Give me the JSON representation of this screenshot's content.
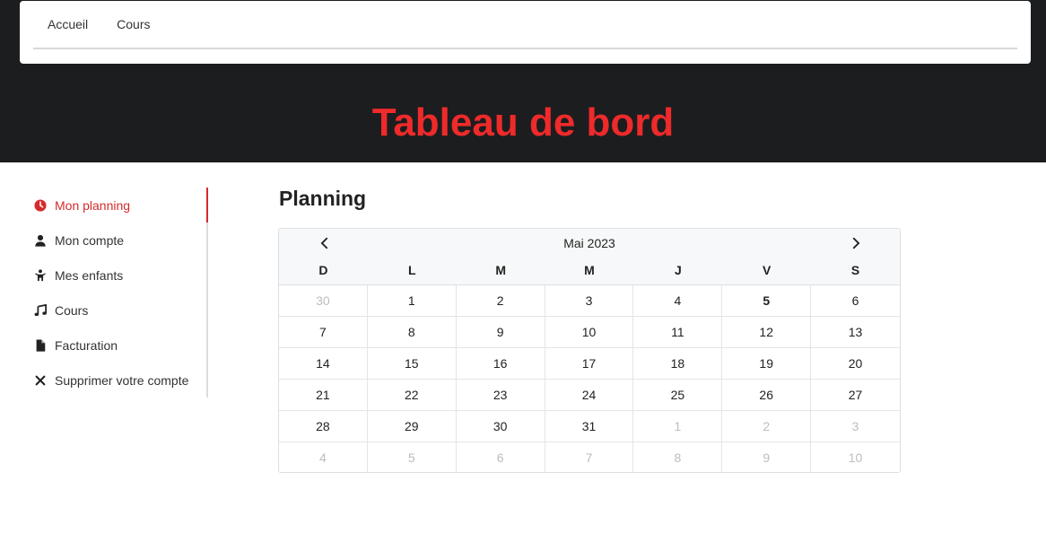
{
  "nav": {
    "items": [
      {
        "label": "Accueil"
      },
      {
        "label": "Cours"
      }
    ]
  },
  "hero": {
    "title": "Tableau de bord"
  },
  "sidebar": {
    "items": [
      {
        "label": "Mon planning",
        "icon": "clock-icon",
        "active": true
      },
      {
        "label": "Mon compte",
        "icon": "user-icon"
      },
      {
        "label": "Mes enfants",
        "icon": "child-icon"
      },
      {
        "label": "Cours",
        "icon": "music-icon"
      },
      {
        "label": "Facturation",
        "icon": "file-icon"
      },
      {
        "label": "Supprimer votre compte",
        "icon": "close-icon"
      }
    ]
  },
  "planning": {
    "title": "Planning",
    "month": "Mai 2023",
    "weekdays": [
      "D",
      "L",
      "M",
      "M",
      "J",
      "V",
      "S"
    ],
    "days": [
      {
        "n": "30",
        "muted": true
      },
      {
        "n": "1"
      },
      {
        "n": "2"
      },
      {
        "n": "3"
      },
      {
        "n": "4"
      },
      {
        "n": "5",
        "today": true
      },
      {
        "n": "6"
      },
      {
        "n": "7"
      },
      {
        "n": "8"
      },
      {
        "n": "9"
      },
      {
        "n": "10"
      },
      {
        "n": "11"
      },
      {
        "n": "12"
      },
      {
        "n": "13"
      },
      {
        "n": "14"
      },
      {
        "n": "15"
      },
      {
        "n": "16"
      },
      {
        "n": "17"
      },
      {
        "n": "18"
      },
      {
        "n": "19"
      },
      {
        "n": "20"
      },
      {
        "n": "21"
      },
      {
        "n": "22"
      },
      {
        "n": "23"
      },
      {
        "n": "24"
      },
      {
        "n": "25"
      },
      {
        "n": "26"
      },
      {
        "n": "27"
      },
      {
        "n": "28"
      },
      {
        "n": "29"
      },
      {
        "n": "30"
      },
      {
        "n": "31"
      },
      {
        "n": "1",
        "muted": true
      },
      {
        "n": "2",
        "muted": true
      },
      {
        "n": "3",
        "muted": true
      },
      {
        "n": "4",
        "muted": true
      },
      {
        "n": "5",
        "muted": true
      },
      {
        "n": "6",
        "muted": true
      },
      {
        "n": "7",
        "muted": true
      },
      {
        "n": "8",
        "muted": true
      },
      {
        "n": "9",
        "muted": true
      },
      {
        "n": "10",
        "muted": true
      }
    ]
  },
  "colors": {
    "accent": "#ee2a2a",
    "header_bg": "#1c1d1f",
    "sidebar_active": "#d62a2a"
  }
}
